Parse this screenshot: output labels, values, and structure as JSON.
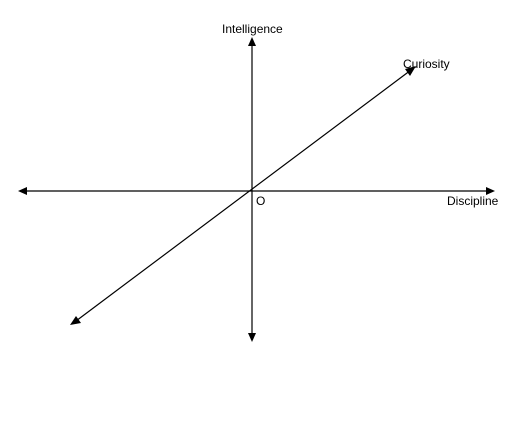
{
  "diagram": {
    "labels": {
      "vertical_axis": "Intelligence",
      "horizontal_axis": "Discipline",
      "diagonal_axis": "Curiosity",
      "origin": "O"
    },
    "line_color": "#000000",
    "background_color": "#ffffff"
  }
}
